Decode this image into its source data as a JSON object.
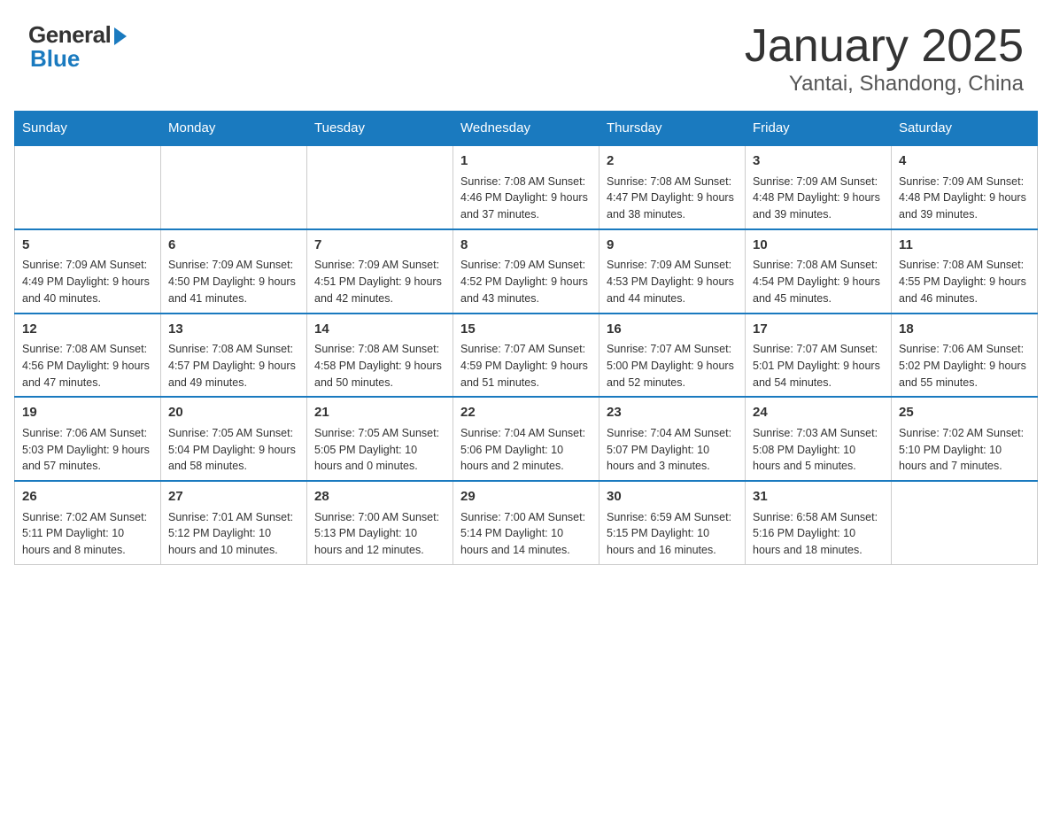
{
  "logo": {
    "general": "General",
    "blue": "Blue"
  },
  "title": "January 2025",
  "subtitle": "Yantai, Shandong, China",
  "days_of_week": [
    "Sunday",
    "Monday",
    "Tuesday",
    "Wednesday",
    "Thursday",
    "Friday",
    "Saturday"
  ],
  "weeks": [
    {
      "days": [
        {
          "num": "",
          "info": ""
        },
        {
          "num": "",
          "info": ""
        },
        {
          "num": "",
          "info": ""
        },
        {
          "num": "1",
          "info": "Sunrise: 7:08 AM\nSunset: 4:46 PM\nDaylight: 9 hours\nand 37 minutes."
        },
        {
          "num": "2",
          "info": "Sunrise: 7:08 AM\nSunset: 4:47 PM\nDaylight: 9 hours\nand 38 minutes."
        },
        {
          "num": "3",
          "info": "Sunrise: 7:09 AM\nSunset: 4:48 PM\nDaylight: 9 hours\nand 39 minutes."
        },
        {
          "num": "4",
          "info": "Sunrise: 7:09 AM\nSunset: 4:48 PM\nDaylight: 9 hours\nand 39 minutes."
        }
      ]
    },
    {
      "days": [
        {
          "num": "5",
          "info": "Sunrise: 7:09 AM\nSunset: 4:49 PM\nDaylight: 9 hours\nand 40 minutes."
        },
        {
          "num": "6",
          "info": "Sunrise: 7:09 AM\nSunset: 4:50 PM\nDaylight: 9 hours\nand 41 minutes."
        },
        {
          "num": "7",
          "info": "Sunrise: 7:09 AM\nSunset: 4:51 PM\nDaylight: 9 hours\nand 42 minutes."
        },
        {
          "num": "8",
          "info": "Sunrise: 7:09 AM\nSunset: 4:52 PM\nDaylight: 9 hours\nand 43 minutes."
        },
        {
          "num": "9",
          "info": "Sunrise: 7:09 AM\nSunset: 4:53 PM\nDaylight: 9 hours\nand 44 minutes."
        },
        {
          "num": "10",
          "info": "Sunrise: 7:08 AM\nSunset: 4:54 PM\nDaylight: 9 hours\nand 45 minutes."
        },
        {
          "num": "11",
          "info": "Sunrise: 7:08 AM\nSunset: 4:55 PM\nDaylight: 9 hours\nand 46 minutes."
        }
      ]
    },
    {
      "days": [
        {
          "num": "12",
          "info": "Sunrise: 7:08 AM\nSunset: 4:56 PM\nDaylight: 9 hours\nand 47 minutes."
        },
        {
          "num": "13",
          "info": "Sunrise: 7:08 AM\nSunset: 4:57 PM\nDaylight: 9 hours\nand 49 minutes."
        },
        {
          "num": "14",
          "info": "Sunrise: 7:08 AM\nSunset: 4:58 PM\nDaylight: 9 hours\nand 50 minutes."
        },
        {
          "num": "15",
          "info": "Sunrise: 7:07 AM\nSunset: 4:59 PM\nDaylight: 9 hours\nand 51 minutes."
        },
        {
          "num": "16",
          "info": "Sunrise: 7:07 AM\nSunset: 5:00 PM\nDaylight: 9 hours\nand 52 minutes."
        },
        {
          "num": "17",
          "info": "Sunrise: 7:07 AM\nSunset: 5:01 PM\nDaylight: 9 hours\nand 54 minutes."
        },
        {
          "num": "18",
          "info": "Sunrise: 7:06 AM\nSunset: 5:02 PM\nDaylight: 9 hours\nand 55 minutes."
        }
      ]
    },
    {
      "days": [
        {
          "num": "19",
          "info": "Sunrise: 7:06 AM\nSunset: 5:03 PM\nDaylight: 9 hours\nand 57 minutes."
        },
        {
          "num": "20",
          "info": "Sunrise: 7:05 AM\nSunset: 5:04 PM\nDaylight: 9 hours\nand 58 minutes."
        },
        {
          "num": "21",
          "info": "Sunrise: 7:05 AM\nSunset: 5:05 PM\nDaylight: 10 hours\nand 0 minutes."
        },
        {
          "num": "22",
          "info": "Sunrise: 7:04 AM\nSunset: 5:06 PM\nDaylight: 10 hours\nand 2 minutes."
        },
        {
          "num": "23",
          "info": "Sunrise: 7:04 AM\nSunset: 5:07 PM\nDaylight: 10 hours\nand 3 minutes."
        },
        {
          "num": "24",
          "info": "Sunrise: 7:03 AM\nSunset: 5:08 PM\nDaylight: 10 hours\nand 5 minutes."
        },
        {
          "num": "25",
          "info": "Sunrise: 7:02 AM\nSunset: 5:10 PM\nDaylight: 10 hours\nand 7 minutes."
        }
      ]
    },
    {
      "days": [
        {
          "num": "26",
          "info": "Sunrise: 7:02 AM\nSunset: 5:11 PM\nDaylight: 10 hours\nand 8 minutes."
        },
        {
          "num": "27",
          "info": "Sunrise: 7:01 AM\nSunset: 5:12 PM\nDaylight: 10 hours\nand 10 minutes."
        },
        {
          "num": "28",
          "info": "Sunrise: 7:00 AM\nSunset: 5:13 PM\nDaylight: 10 hours\nand 12 minutes."
        },
        {
          "num": "29",
          "info": "Sunrise: 7:00 AM\nSunset: 5:14 PM\nDaylight: 10 hours\nand 14 minutes."
        },
        {
          "num": "30",
          "info": "Sunrise: 6:59 AM\nSunset: 5:15 PM\nDaylight: 10 hours\nand 16 minutes."
        },
        {
          "num": "31",
          "info": "Sunrise: 6:58 AM\nSunset: 5:16 PM\nDaylight: 10 hours\nand 18 minutes."
        },
        {
          "num": "",
          "info": ""
        }
      ]
    }
  ]
}
